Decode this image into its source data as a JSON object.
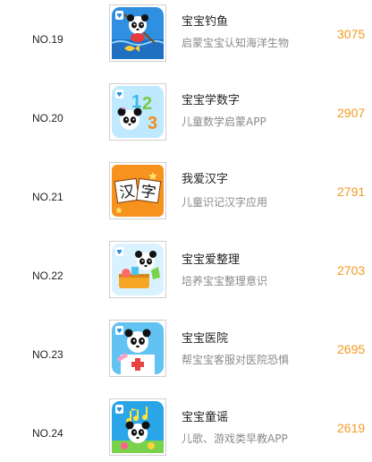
{
  "items": [
    {
      "rank": "NO.19",
      "title": "宝宝钓鱼",
      "desc": "启蒙宝宝认知海洋生物",
      "score": "3075",
      "icon": "panda-fishing-icon"
    },
    {
      "rank": "NO.20",
      "title": "宝宝学数字",
      "desc": "儿童数学启蒙APP",
      "score": "2907",
      "icon": "panda-numbers-icon"
    },
    {
      "rank": "NO.21",
      "title": "我爱汉字",
      "desc": "儿童识记汉字应用",
      "score": "2791",
      "icon": "chinese-characters-icon",
      "icon_text": [
        "汉",
        "字"
      ]
    },
    {
      "rank": "NO.22",
      "title": "宝宝爱整理",
      "desc": "培养宝宝整理意识",
      "score": "2703",
      "icon": "panda-tidying-icon"
    },
    {
      "rank": "NO.23",
      "title": "宝宝医院",
      "desc": "帮宝宝客服对医院恐惧",
      "score": "2695",
      "icon": "panda-hospital-icon"
    },
    {
      "rank": "NO.24",
      "title": "宝宝童谣",
      "desc": "儿歌、游戏类早教APP",
      "score": "2619",
      "icon": "panda-music-icon"
    }
  ],
  "colors": {
    "score": "#f29a1f",
    "rank": "#222222",
    "title": "#222222",
    "desc": "#8a8a8a"
  }
}
